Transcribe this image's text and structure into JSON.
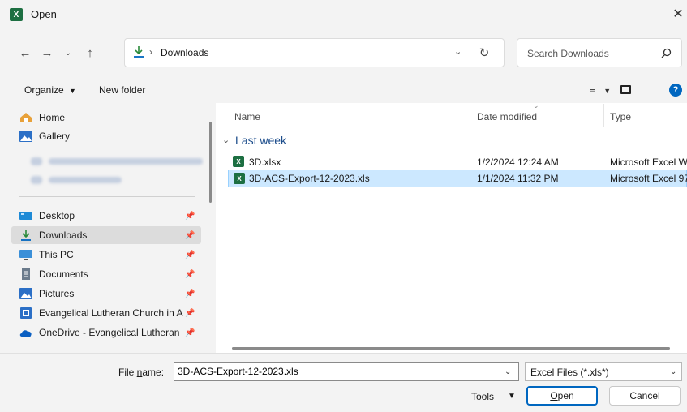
{
  "window": {
    "title": "Open",
    "app_icon_label": "X"
  },
  "nav": {
    "breadcrumb_sep": "›",
    "address": "Downloads",
    "search_placeholder": "Search Downloads"
  },
  "toolbar": {
    "organize": "Organize",
    "new_folder": "New folder"
  },
  "sidebar": {
    "top_items": [
      {
        "label": "Home",
        "icon": "home-icon"
      },
      {
        "label": "Gallery",
        "icon": "gallery-icon"
      }
    ],
    "pinned_items": [
      {
        "label": "Desktop",
        "icon": "desktop-icon"
      },
      {
        "label": "Downloads",
        "icon": "downloads-icon",
        "selected": true
      },
      {
        "label": "This PC",
        "icon": "pc-icon"
      },
      {
        "label": "Documents",
        "icon": "documents-icon"
      },
      {
        "label": "Pictures",
        "icon": "pictures-icon"
      },
      {
        "label": "Evangelical Lutheran Church in A",
        "icon": "library-icon"
      },
      {
        "label": "OneDrive - Evangelical Lutheran",
        "icon": "onedrive-icon"
      }
    ]
  },
  "filelist": {
    "columns": [
      "Name",
      "Date modified",
      "Type"
    ],
    "group": "Last week",
    "rows": [
      {
        "name": "3D.xlsx",
        "date": "1/2/2024 12:24 AM",
        "type": "Microsoft Excel W",
        "selected": false
      },
      {
        "name": "3D-ACS-Export-12-2023.xls",
        "date": "1/1/2024 11:32 PM",
        "type": "Microsoft Excel 97",
        "selected": true
      }
    ]
  },
  "bottom": {
    "filename_label_pre": "File ",
    "filename_label_accel": "n",
    "filename_label_post": "ame:",
    "filename_value": "3D-ACS-Export-12-2023.xls",
    "filter": "Excel Files (*.xls*)",
    "tools_pre": "Too",
    "tools_accel": "l",
    "tools_post": "s",
    "open_accel": "O",
    "open_rest": "pen",
    "cancel": "Cancel"
  },
  "colors": {
    "accent": "#0067c0",
    "selection": "#cce8ff",
    "excel_green": "#1d6f42",
    "group_text": "#1e4e8c"
  }
}
